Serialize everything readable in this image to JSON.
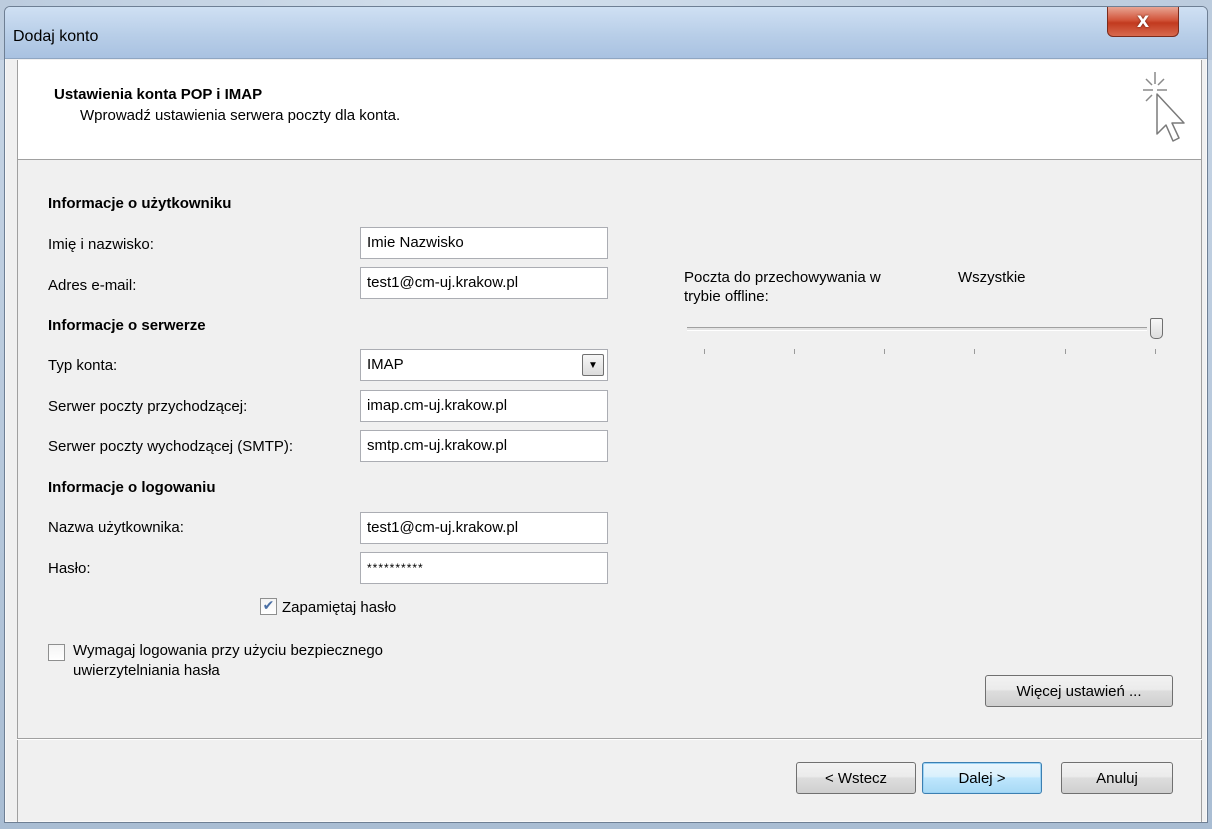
{
  "window": {
    "title": "Dodaj konto",
    "close_label": "X"
  },
  "header": {
    "title": "Ustawienia konta POP i IMAP",
    "subtitle": "Wprowadź ustawienia serwera poczty dla konta."
  },
  "user_info": {
    "section_label": "Informacje o użytkowniku",
    "name_label": "Imię i nazwisko:",
    "name_value": "Imie Nazwisko",
    "email_label": "Adres e-mail:",
    "email_value": "test1@cm-uj.krakow.pl"
  },
  "server_info": {
    "section_label": "Informacje o serwerze",
    "account_type_label": "Typ konta:",
    "account_type_value": "IMAP",
    "incoming_label": "Serwer poczty przychodzącej:",
    "incoming_value": "imap.cm-uj.krakow.pl",
    "outgoing_label": "Serwer poczty wychodzącej (SMTP):",
    "outgoing_value": "smtp.cm-uj.krakow.pl"
  },
  "login_info": {
    "section_label": "Informacje o logowaniu",
    "username_label": "Nazwa użytkownika:",
    "username_value": "test1@cm-uj.krakow.pl",
    "password_label": "Hasło:",
    "password_value": "**********",
    "remember_label": "Zapamiętaj hasło",
    "remember_checked": true,
    "spa_label_line1": "Wymagaj logowania przy użyciu bezpiecznego",
    "spa_label_line2": "uwierzytelniania hasła",
    "spa_checked": false
  },
  "offline": {
    "label_line1": "Poczta do przechowywania w",
    "label_line2": "trybie offline:",
    "value": "Wszystkie",
    "slider_fraction": 1.0
  },
  "buttons": {
    "more_settings": "Więcej ustawień ...",
    "back": "< Wstecz",
    "next": "Dalej >",
    "cancel": "Anuluj"
  },
  "icons": {
    "wizard": "cursor-sparkle-icon",
    "dropdown": "chevron-down-icon",
    "close": "close-icon"
  }
}
